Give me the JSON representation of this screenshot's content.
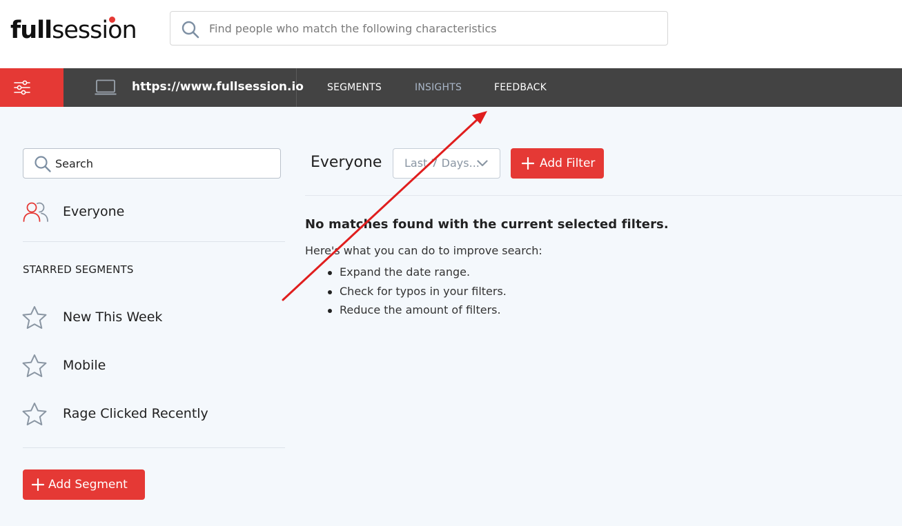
{
  "app": {
    "logo_part1": "full",
    "logo_part2": "session",
    "brand_color": "#e53935"
  },
  "global_search": {
    "placeholder": "Find people who match the following characteristics",
    "value": ""
  },
  "nav": {
    "site_url": "https://www.fullsession.io",
    "tabs": [
      {
        "label": "SEGMENTS",
        "active": false
      },
      {
        "label": "INSIGHTS",
        "active": true
      },
      {
        "label": "FEEDBACK",
        "active": false
      }
    ],
    "bar_color": "#434343"
  },
  "sidebar": {
    "search_placeholder": "Search",
    "everyone_label": "Everyone",
    "starred_title": "STARRED SEGMENTS",
    "starred_segments": [
      {
        "label": "New This Week",
        "icon": "star-outline-icon"
      },
      {
        "label": "Mobile",
        "icon": "star-outline-icon"
      },
      {
        "label": "Rage Clicked Recently",
        "icon": "star-outline-icon"
      }
    ],
    "add_segment_label": "Add Segment"
  },
  "content": {
    "segment_title": "Everyone",
    "date_range": "Last 7 Days...",
    "add_filter_label": "Add Filter",
    "empty_title": "No matches found with the current selected filters.",
    "empty_hint": "Here's what you can do to improve search:",
    "tips": [
      "Expand the date range.",
      "Check for typos in your filters.",
      "Reduce the amount of filters."
    ]
  },
  "annotation": {
    "arrow_color": "#e01e1e"
  }
}
